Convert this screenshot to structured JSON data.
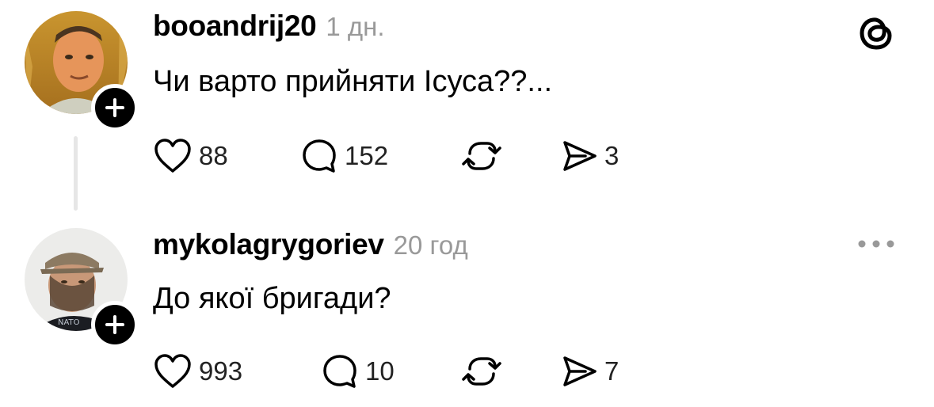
{
  "posts": [
    {
      "username": "booandrij20",
      "time": "1 дн.",
      "text": "Чи варто прийняти Ісуса??...",
      "likes": "88",
      "replies": "152",
      "shares": "3",
      "avatar_icon": "user-avatar-photo",
      "corner_icon": "threads-logo-icon"
    },
    {
      "username": "mykolagrygoriev",
      "time": "20 год",
      "text": "До якої бригади?",
      "likes": "993",
      "replies": "10",
      "shares": "7",
      "avatar_icon": "user-avatar-photo",
      "corner_icon": "more-options-icon"
    }
  ],
  "colors": {
    "text": "#000000",
    "muted": "#999999",
    "thread_line": "#e6e6e6",
    "badge": "#000000"
  }
}
